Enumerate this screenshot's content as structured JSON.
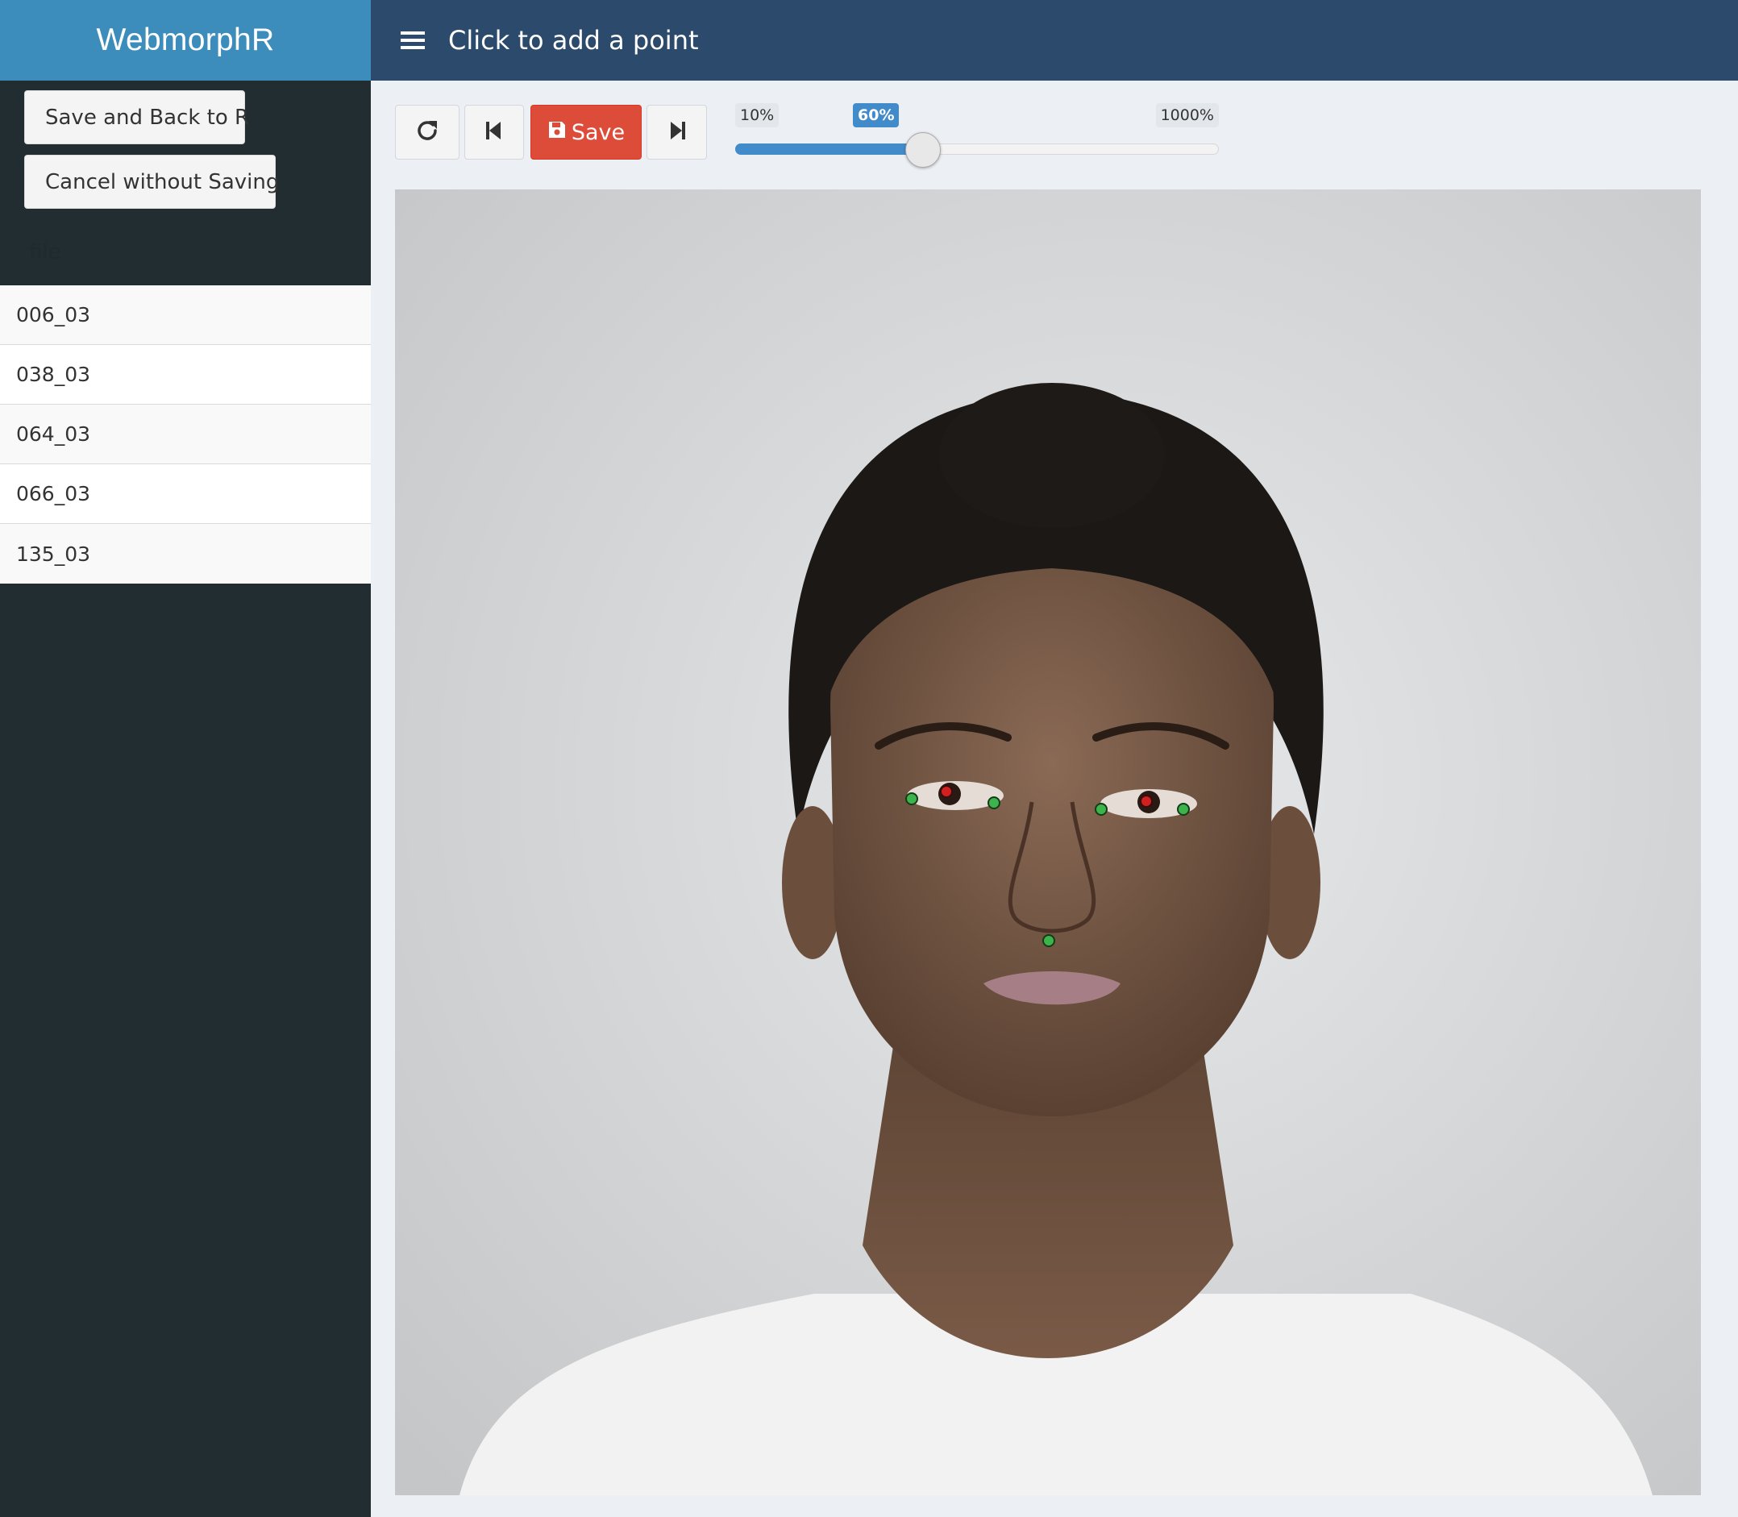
{
  "app": {
    "title": "WebmorphR"
  },
  "header": {
    "title": "Click to add a point",
    "menu_icon": "hamburger-icon"
  },
  "sidebar": {
    "save_back_label": "Save and Back to R",
    "cancel_label": "Cancel without Saving",
    "file_header": "file",
    "files": [
      "006_03",
      "038_03",
      "064_03",
      "066_03",
      "135_03"
    ]
  },
  "toolbar": {
    "refresh_icon": "refresh-icon",
    "prev_icon": "skip-previous-icon",
    "save_label": "Save",
    "save_icon": "floppy-disk-icon",
    "next_icon": "skip-next-icon"
  },
  "zoom": {
    "min_label": "10%",
    "max_label": "1000%",
    "value_label": "60%",
    "value_percent": 60
  },
  "colors": {
    "brand": "#3c8dbc",
    "header": "#2c4a6b",
    "sidebar": "#222d32",
    "save_button": "#dd4b39",
    "slider_accent": "#428bca",
    "point_pupil": "#d02020",
    "point_landmark": "#3cb44b"
  },
  "delineation": {
    "point_count": 7,
    "point_types": [
      "left-eye-outer",
      "left-pupil",
      "left-eye-inner",
      "right-eye-inner",
      "right-pupil",
      "right-eye-outer",
      "nose-base"
    ]
  }
}
